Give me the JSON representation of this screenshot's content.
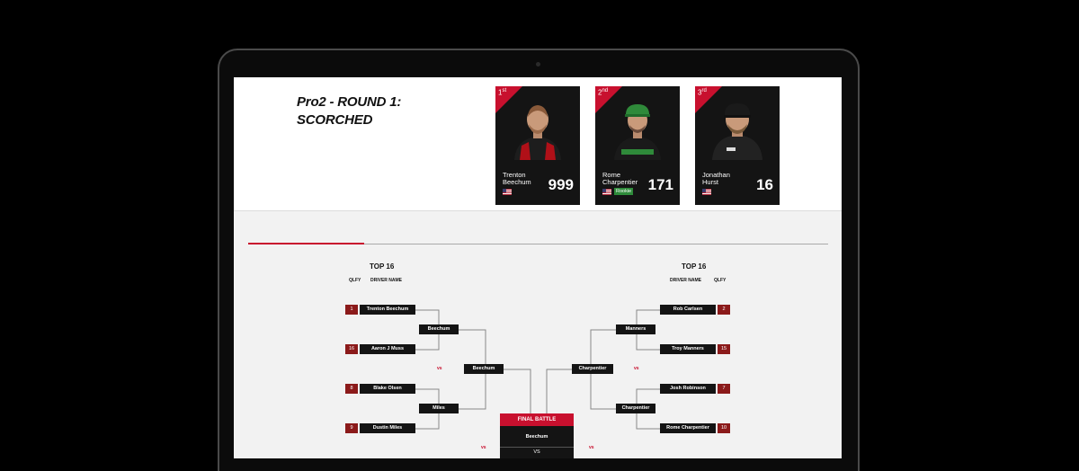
{
  "event": {
    "title_line1": "Pro2 - ROUND 1:",
    "title_line2": "SCORCHED"
  },
  "podium": [
    {
      "rank": "1",
      "suffix": "st",
      "first": "Trenton",
      "last": "Beechum",
      "score": "999",
      "rookie": ""
    },
    {
      "rank": "2",
      "suffix": "nd",
      "first": "Rome",
      "last": "Charpentier",
      "score": "171",
      "rookie": "Rookie"
    },
    {
      "rank": "3",
      "suffix": "rd",
      "first": "Jonathan",
      "last": "Hurst",
      "score": "16",
      "rookie": ""
    }
  ],
  "bracket": {
    "left": {
      "heading": "TOP 16",
      "qlfy": "QLFY",
      "driver": "DRIVER NAME"
    },
    "right": {
      "heading": "TOP 16",
      "qlfy": "QLFY",
      "driver": "DRIVER NAME"
    },
    "left_r1": [
      {
        "seed": "1",
        "name": "Trenton Beechum"
      },
      {
        "seed": "16",
        "name": "Aaron J Muss"
      },
      {
        "seed": "8",
        "name": "Blake Olsen"
      },
      {
        "seed": "9",
        "name": "Dustin Miles"
      }
    ],
    "right_r1": [
      {
        "seed": "2",
        "name": "Rob Carlsen"
      },
      {
        "seed": "15",
        "name": "Troy Manners"
      },
      {
        "seed": "7",
        "name": "Josh Robinson"
      },
      {
        "seed": "10",
        "name": "Rome Charpentier"
      }
    ],
    "left_r2": [
      "Beechum",
      "Miles"
    ],
    "right_r2": [
      "Manners",
      "Charpentier"
    ],
    "left_r3": "Beechum",
    "right_r3": "Charpentier",
    "vs": "vs",
    "final": {
      "title": "FINAL BATTLE",
      "top": "Beechum",
      "vs": "VS"
    }
  },
  "colors": {
    "accent": "#c8102e",
    "seed": "#8b1a1a",
    "slot": "#141414"
  }
}
